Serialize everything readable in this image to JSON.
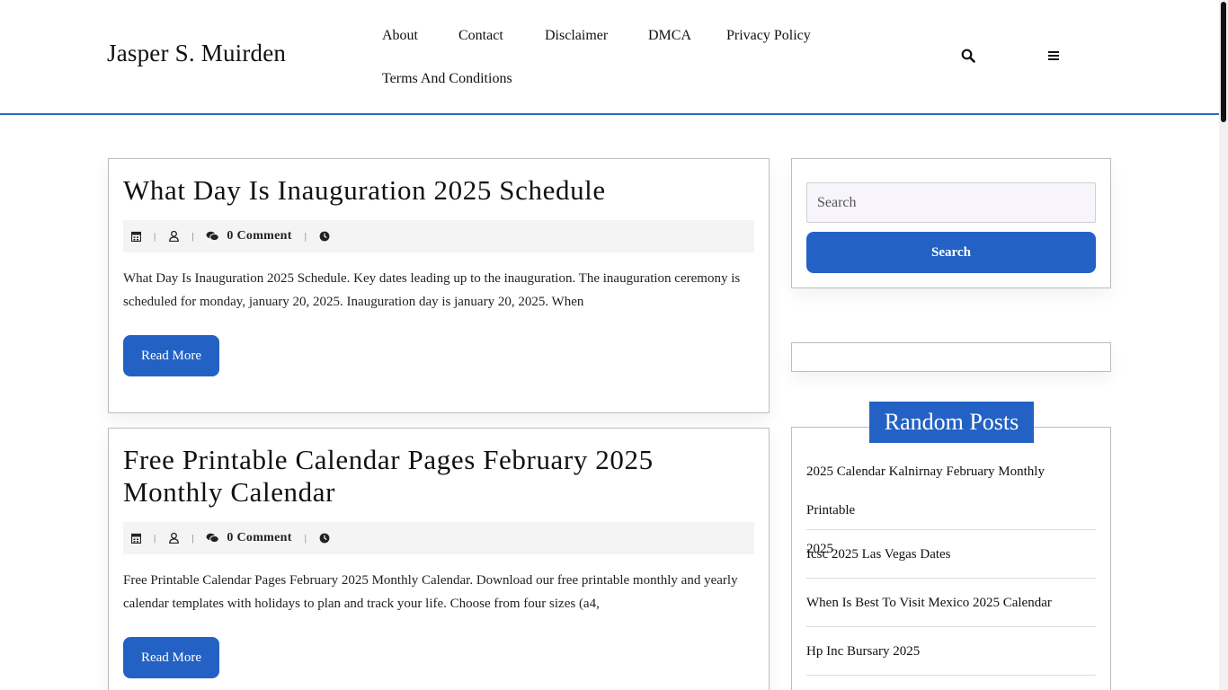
{
  "site": {
    "title": "Jasper S. Muirden"
  },
  "nav": {
    "items": [
      "About",
      "Contact",
      "Disclaimer",
      "DMCA",
      "Privacy Policy",
      "Terms And Conditions"
    ]
  },
  "header_icons": {
    "search": "search-icon",
    "menu": "menu-icon"
  },
  "posts": [
    {
      "title": "What Day Is Inauguration 2025 Schedule",
      "comment_count": "0 Comment",
      "excerpt_line1": "What Day Is Inauguration 2025 Schedule. Key dates leading up to the inauguration. The inauguration ceremony is",
      "excerpt_line2": "scheduled for monday, january 20, 2025. Inauguration day is january 20, 2025. When",
      "read_more": "Read More"
    },
    {
      "title_line1": "Free Printable Calendar Pages February 2025",
      "title_line2": "Monthly Calendar",
      "comment_count": "0 Comment",
      "excerpt_line1": "Free Printable Calendar Pages February 2025 Monthly Calendar. Download our free printable monthly and yearly",
      "excerpt_line2": "calendar templates with holidays to plan and track your life. Choose from four sizes (a4,",
      "read_more": "Read More"
    }
  ],
  "sidebar": {
    "search_placeholder": "Search",
    "search_button": "Search",
    "random_posts_heading": "Random Posts",
    "random_posts": [
      {
        "line1": "2025 Calendar Kalnirnay February Monthly Printable",
        "line2": "2025"
      },
      {
        "line1": "Icsc 2025 Las Vegas Dates"
      },
      {
        "line1": "When Is Best To Visit Mexico 2025 Calendar"
      },
      {
        "line1": "Hp Inc Bursary 2025"
      }
    ]
  },
  "colors": {
    "accent": "#2362c4",
    "header_border": "#2f6bc6",
    "meta_bg": "#f4f4f4"
  }
}
